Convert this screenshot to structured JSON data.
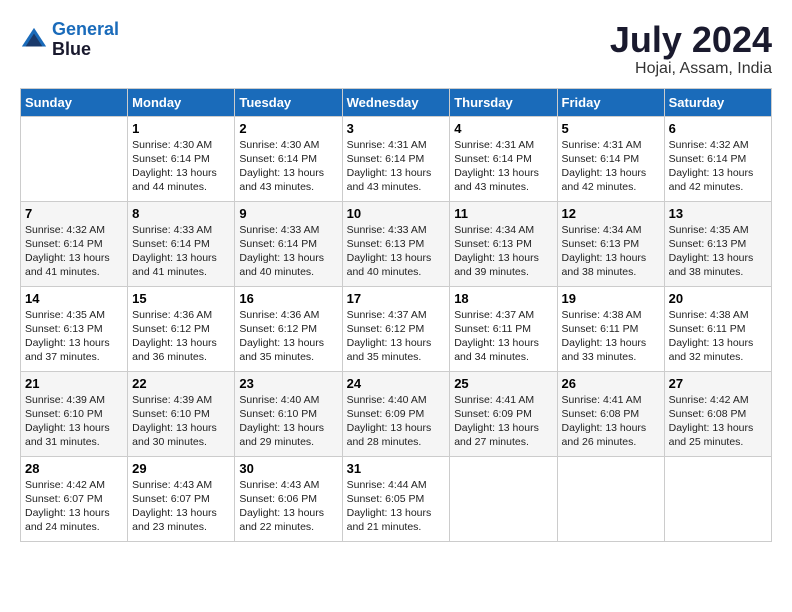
{
  "header": {
    "logo_line1": "General",
    "logo_line2": "Blue",
    "month_year": "July 2024",
    "location": "Hojai, Assam, India"
  },
  "weekdays": [
    "Sunday",
    "Monday",
    "Tuesday",
    "Wednesday",
    "Thursday",
    "Friday",
    "Saturday"
  ],
  "weeks": [
    [
      null,
      {
        "day": 1,
        "sunrise": "4:30 AM",
        "sunset": "6:14 PM",
        "daylight": "13 hours and 44 minutes."
      },
      {
        "day": 2,
        "sunrise": "4:30 AM",
        "sunset": "6:14 PM",
        "daylight": "13 hours and 43 minutes."
      },
      {
        "day": 3,
        "sunrise": "4:31 AM",
        "sunset": "6:14 PM",
        "daylight": "13 hours and 43 minutes."
      },
      {
        "day": 4,
        "sunrise": "4:31 AM",
        "sunset": "6:14 PM",
        "daylight": "13 hours and 43 minutes."
      },
      {
        "day": 5,
        "sunrise": "4:31 AM",
        "sunset": "6:14 PM",
        "daylight": "13 hours and 42 minutes."
      },
      {
        "day": 6,
        "sunrise": "4:32 AM",
        "sunset": "6:14 PM",
        "daylight": "13 hours and 42 minutes."
      }
    ],
    [
      {
        "day": 7,
        "sunrise": "4:32 AM",
        "sunset": "6:14 PM",
        "daylight": "13 hours and 41 minutes."
      },
      {
        "day": 8,
        "sunrise": "4:33 AM",
        "sunset": "6:14 PM",
        "daylight": "13 hours and 41 minutes."
      },
      {
        "day": 9,
        "sunrise": "4:33 AM",
        "sunset": "6:14 PM",
        "daylight": "13 hours and 40 minutes."
      },
      {
        "day": 10,
        "sunrise": "4:33 AM",
        "sunset": "6:13 PM",
        "daylight": "13 hours and 40 minutes."
      },
      {
        "day": 11,
        "sunrise": "4:34 AM",
        "sunset": "6:13 PM",
        "daylight": "13 hours and 39 minutes."
      },
      {
        "day": 12,
        "sunrise": "4:34 AM",
        "sunset": "6:13 PM",
        "daylight": "13 hours and 38 minutes."
      },
      {
        "day": 13,
        "sunrise": "4:35 AM",
        "sunset": "6:13 PM",
        "daylight": "13 hours and 38 minutes."
      }
    ],
    [
      {
        "day": 14,
        "sunrise": "4:35 AM",
        "sunset": "6:13 PM",
        "daylight": "13 hours and 37 minutes."
      },
      {
        "day": 15,
        "sunrise": "4:36 AM",
        "sunset": "6:12 PM",
        "daylight": "13 hours and 36 minutes."
      },
      {
        "day": 16,
        "sunrise": "4:36 AM",
        "sunset": "6:12 PM",
        "daylight": "13 hours and 35 minutes."
      },
      {
        "day": 17,
        "sunrise": "4:37 AM",
        "sunset": "6:12 PM",
        "daylight": "13 hours and 35 minutes."
      },
      {
        "day": 18,
        "sunrise": "4:37 AM",
        "sunset": "6:11 PM",
        "daylight": "13 hours and 34 minutes."
      },
      {
        "day": 19,
        "sunrise": "4:38 AM",
        "sunset": "6:11 PM",
        "daylight": "13 hours and 33 minutes."
      },
      {
        "day": 20,
        "sunrise": "4:38 AM",
        "sunset": "6:11 PM",
        "daylight": "13 hours and 32 minutes."
      }
    ],
    [
      {
        "day": 21,
        "sunrise": "4:39 AM",
        "sunset": "6:10 PM",
        "daylight": "13 hours and 31 minutes."
      },
      {
        "day": 22,
        "sunrise": "4:39 AM",
        "sunset": "6:10 PM",
        "daylight": "13 hours and 30 minutes."
      },
      {
        "day": 23,
        "sunrise": "4:40 AM",
        "sunset": "6:10 PM",
        "daylight": "13 hours and 29 minutes."
      },
      {
        "day": 24,
        "sunrise": "4:40 AM",
        "sunset": "6:09 PM",
        "daylight": "13 hours and 28 minutes."
      },
      {
        "day": 25,
        "sunrise": "4:41 AM",
        "sunset": "6:09 PM",
        "daylight": "13 hours and 27 minutes."
      },
      {
        "day": 26,
        "sunrise": "4:41 AM",
        "sunset": "6:08 PM",
        "daylight": "13 hours and 26 minutes."
      },
      {
        "day": 27,
        "sunrise": "4:42 AM",
        "sunset": "6:08 PM",
        "daylight": "13 hours and 25 minutes."
      }
    ],
    [
      {
        "day": 28,
        "sunrise": "4:42 AM",
        "sunset": "6:07 PM",
        "daylight": "13 hours and 24 minutes."
      },
      {
        "day": 29,
        "sunrise": "4:43 AM",
        "sunset": "6:07 PM",
        "daylight": "13 hours and 23 minutes."
      },
      {
        "day": 30,
        "sunrise": "4:43 AM",
        "sunset": "6:06 PM",
        "daylight": "13 hours and 22 minutes."
      },
      {
        "day": 31,
        "sunrise": "4:44 AM",
        "sunset": "6:05 PM",
        "daylight": "13 hours and 21 minutes."
      },
      null,
      null,
      null
    ]
  ]
}
